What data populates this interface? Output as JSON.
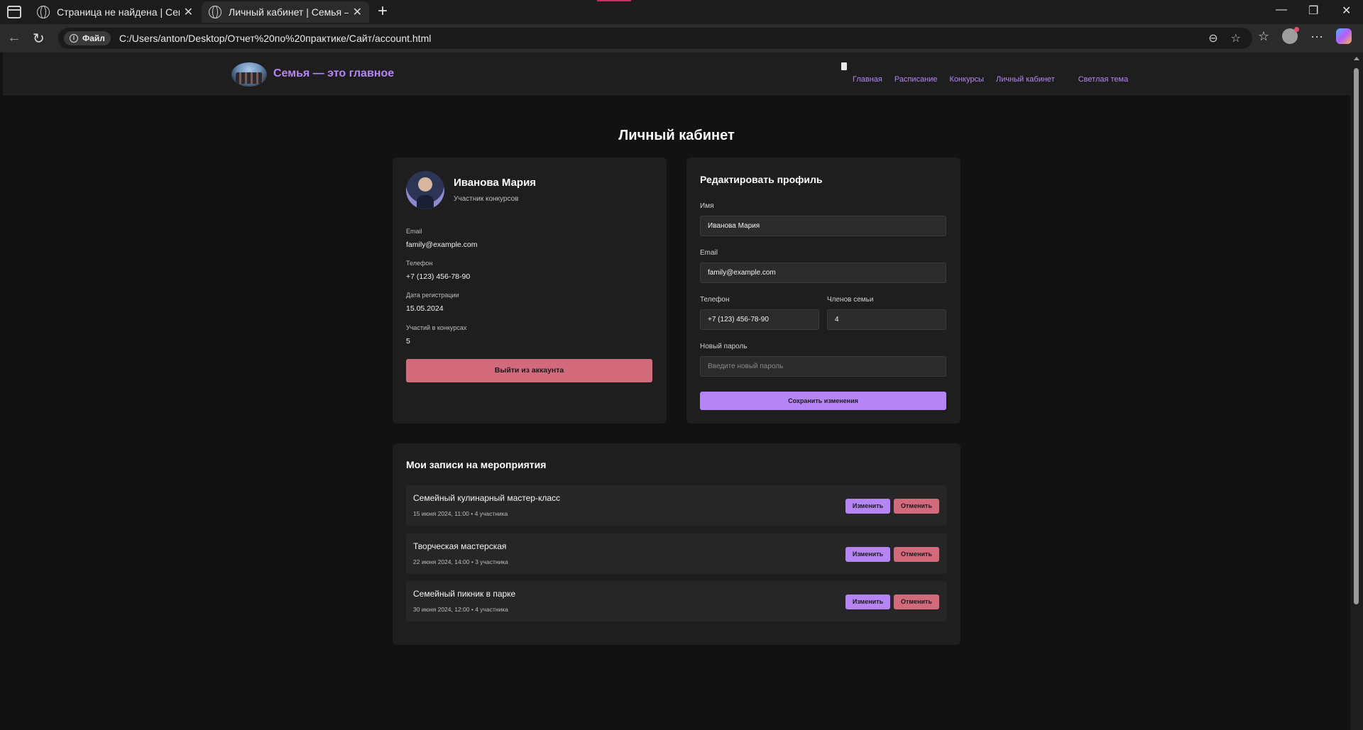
{
  "browser": {
    "tabs": [
      {
        "title": "Страница не найдена | Семья —"
      },
      {
        "title": "Личный кабинет | Семья — это г"
      }
    ],
    "address": {
      "chip": "Файл",
      "url": "C:/Users/anton/Desktop/Отчет%20по%20практике/Сайт/account.html"
    }
  },
  "site": {
    "title": "Семья — это главное",
    "nav": [
      "Главная",
      "Расписание",
      "Конкурсы",
      "Личный кабинет",
      "Светлая тема"
    ]
  },
  "page": {
    "title": "Личный кабинет"
  },
  "profile": {
    "name": "Иванова Мария",
    "role": "Участник конкурсов",
    "fields": [
      {
        "label": "Email",
        "value": "family@example.com"
      },
      {
        "label": "Телефон",
        "value": "+7 (123) 456-78-90"
      },
      {
        "label": "Дата регистрации",
        "value": "15.05.2024"
      },
      {
        "label": "Участий в конкурсах",
        "value": "5"
      }
    ],
    "logout_label": "Выйти из аккаунта"
  },
  "edit": {
    "title": "Редактировать профиль",
    "name_label": "Имя",
    "name_value": "Иванова Мария",
    "email_label": "Email",
    "email_value": "family@example.com",
    "phone_label": "Телефон",
    "phone_value": "+7 (123) 456-78-90",
    "family_label": "Членов семьи",
    "family_value": "4",
    "password_label": "Новый пароль",
    "password_placeholder": "Введите новый пароль",
    "save_label": "Сохранить изменения"
  },
  "events": {
    "title": "Мои записи на мероприятия",
    "edit_label": "Изменить",
    "cancel_label": "Отменить",
    "items": [
      {
        "name": "Семейный кулинарный мастер-класс",
        "meta": "15 июня 2024, 11:00 • 4 участника"
      },
      {
        "name": "Творческая мастерская",
        "meta": "22 июня 2024, 14:00 • 3 участника"
      },
      {
        "name": "Семейный пикник в парке",
        "meta": "30 июня 2024, 12:00 • 4 участника"
      }
    ]
  },
  "colors": {
    "accent": "#b685f5",
    "danger": "#d26a7c",
    "card": "#1e1e1e",
    "background": "#121212"
  }
}
